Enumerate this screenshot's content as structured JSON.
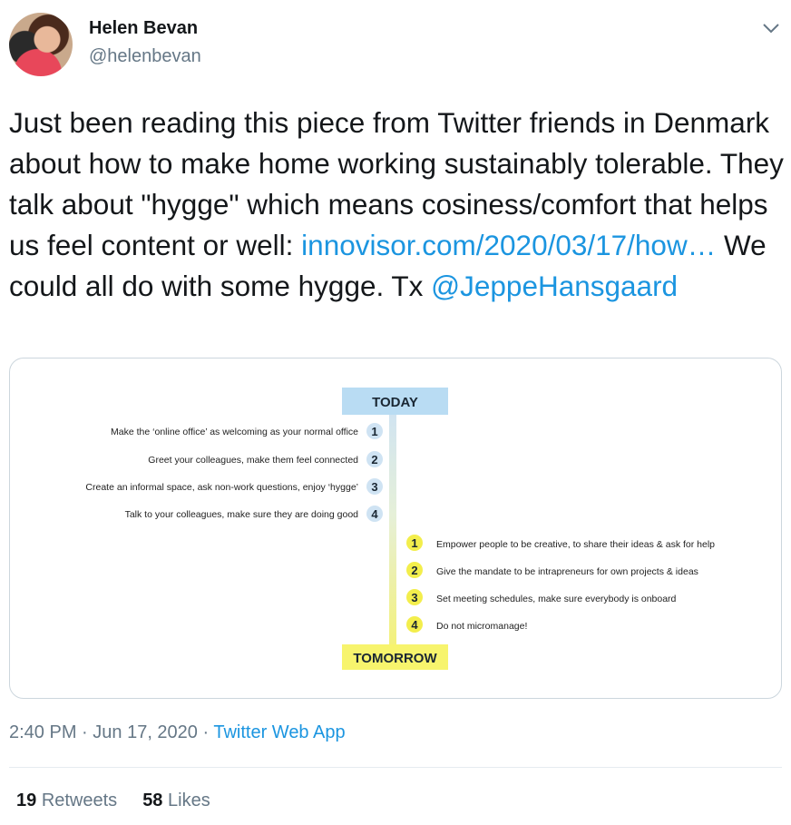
{
  "author": {
    "name": "Helen Bevan",
    "handle": "@helenbevan"
  },
  "tweet": {
    "text_1": "Just been reading this piece from Twitter friends in Denmark about how to make home working sustainably tolerable. They talk about \"hygge\" which means cosiness/comfort that helps us feel content or well: ",
    "link": "innovisor.com/2020/03/17/how…",
    "text_2": " We could all do with some hygge. Tx ",
    "mention": "@JeppeHansgaard"
  },
  "media": {
    "top_label": "TODAY",
    "bottom_label": "TOMORROW",
    "today_items": [
      {
        "num": "1",
        "text": "Make the ‘online office’ as welcoming as your normal office"
      },
      {
        "num": "2",
        "text": "Greet your colleagues, make them feel connected"
      },
      {
        "num": "3",
        "text": "Create an informal space, ask non-work questions, enjoy ‘hygge’"
      },
      {
        "num": "4",
        "text": "Talk to your colleagues, make sure they are doing good"
      }
    ],
    "tomorrow_items": [
      {
        "num": "1",
        "text": "Empower people to be creative, to share their ideas & ask for help"
      },
      {
        "num": "2",
        "text": "Give the mandate to be intrapreneurs for own projects & ideas"
      },
      {
        "num": "3",
        "text": "Set meeting schedules, make sure everybody is onboard"
      },
      {
        "num": "4",
        "text": "Do not micromanage!"
      }
    ],
    "colors": {
      "today_box": "#b9dcf3",
      "tomorrow_box": "#f7f46d",
      "badge_blue": "#cfe3f3",
      "badge_yellow": "#f3ee4c"
    }
  },
  "meta": {
    "time": "2:40 PM",
    "sep1": " · ",
    "date": "Jun 17, 2020",
    "sep2": " · ",
    "source": "Twitter Web App"
  },
  "stats": {
    "retweets_count": "19",
    "retweets_label": "Retweets",
    "likes_count": "58",
    "likes_label": "Likes"
  },
  "icons": {
    "caret": "chevron-down-icon"
  }
}
